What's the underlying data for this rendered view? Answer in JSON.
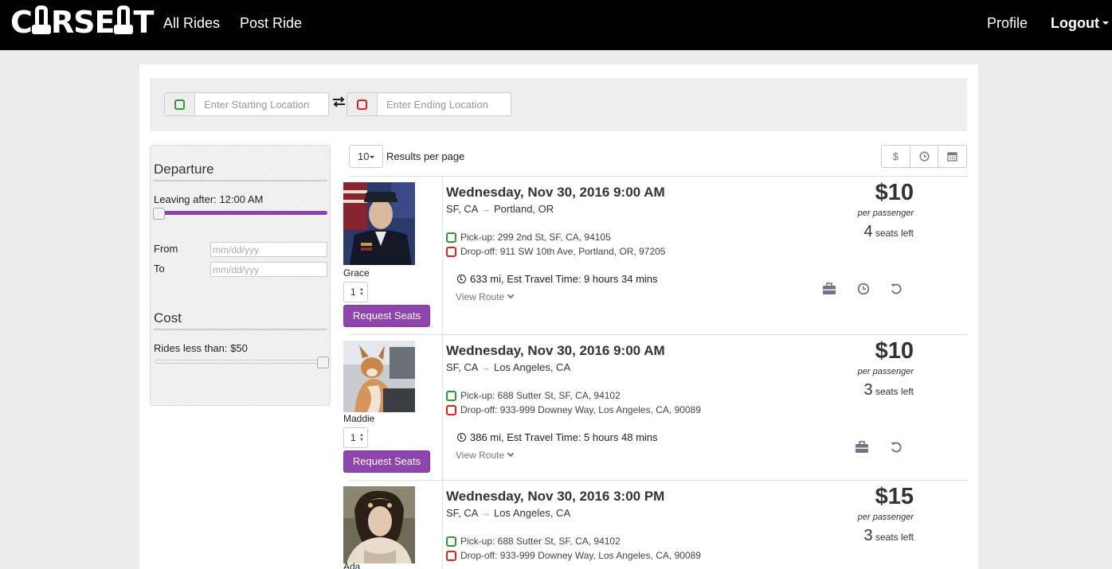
{
  "nav": {
    "brand": "CARSEAT",
    "links": {
      "all_rides": "All Rides",
      "post_ride": "Post Ride",
      "profile": "Profile",
      "logout": "Logout"
    }
  },
  "search": {
    "start_placeholder": "Enter Starting Location",
    "end_placeholder": "Enter Ending Location"
  },
  "filters": {
    "departure_heading": "Departure",
    "leaving_after_label": "Leaving after: 12:00 AM",
    "from_label": "From",
    "to_label": "To",
    "from_placeholder": "mm/dd/yyy",
    "to_placeholder": "mm/dd/yyy",
    "cost_heading": "Cost",
    "rides_less_than_label": "Rides less than: $50"
  },
  "results": {
    "per_page_value": "10",
    "per_page_label": "Results per page",
    "sort_icons": [
      "dollar-icon",
      "clock-icon",
      "calendar-icon"
    ]
  },
  "rides": [
    {
      "driver": "Grace",
      "qty": "1",
      "request_label": "Request Seats",
      "date": "Wednesday, Nov 30, 2016 9:00 AM",
      "origin": "SF, CA",
      "destination": "Portland, OR",
      "pickup": "Pick-up: 299 2nd St, SF, CA, 94105",
      "dropoff": "Drop-off: 911 SW 10th Ave, Portland, OR, 97205",
      "travel": "633 mi, Est Travel Time: 9 hours 34 mins",
      "view_route": "View Route",
      "price": "$10",
      "per_passenger": "per passenger",
      "seats_num": "4",
      "seats_label": "seats left",
      "amenities": [
        "briefcase-icon",
        "clock-icon",
        "undo-icon"
      ]
    },
    {
      "driver": "Maddie",
      "qty": "1",
      "request_label": "Request Seats",
      "date": "Wednesday, Nov 30, 2016 9:00 AM",
      "origin": "SF, CA",
      "destination": "Los Angeles, CA",
      "pickup": "Pick-up: 688 Sutter St, SF, CA, 94102",
      "dropoff": "Drop-off: 933-999 Downey Way, Los Angeles, CA, 90089",
      "travel": "386 mi, Est Travel Time: 5 hours 48 mins",
      "view_route": "View Route",
      "price": "$10",
      "per_passenger": "per passenger",
      "seats_num": "3",
      "seats_label": "seats left",
      "amenities": [
        "briefcase-icon",
        "undo-icon"
      ]
    },
    {
      "driver": "Ada",
      "date": "Wednesday, Nov 30, 2016 3:00 PM",
      "origin": "SF, CA",
      "destination": "Los Angeles, CA",
      "pickup": "Pick-up: 688 Sutter St, SF, CA, 94102",
      "dropoff": "Drop-off: 933-999 Downey Way, Los Angeles, CA, 90089",
      "price": "$15",
      "per_passenger": "per passenger",
      "seats_num": "3",
      "seats_label": "seats left"
    }
  ]
}
